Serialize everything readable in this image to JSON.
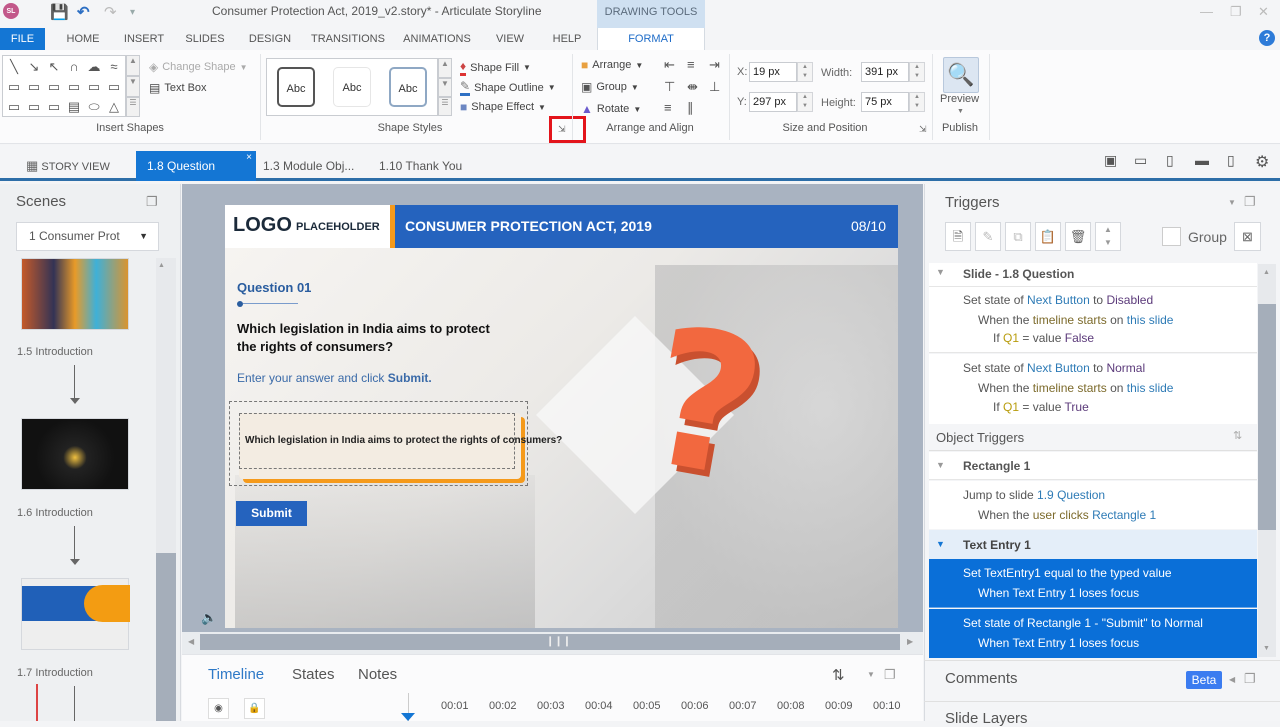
{
  "app": {
    "title": "Consumer Protection Act, 2019_v2.story* - Articulate Storyline",
    "icon_label": "SL",
    "context_tab_group": "DRAWING TOOLS"
  },
  "menu": {
    "tabs": [
      "FILE",
      "HOME",
      "INSERT",
      "SLIDES",
      "DESIGN",
      "TRANSITIONS",
      "ANIMATIONS",
      "VIEW",
      "HELP",
      "FORMAT"
    ],
    "active": "FORMAT"
  },
  "ribbon": {
    "insert_shapes": {
      "label": "Insert Shapes",
      "change_shape": "Change Shape",
      "text_box": "Text Box"
    },
    "shape_styles": {
      "label": "Shape Styles",
      "samples": [
        "Abc",
        "Abc",
        "Abc"
      ],
      "shape_fill": "Shape Fill",
      "shape_outline": "Shape Outline",
      "shape_effect": "Shape Effect"
    },
    "arrange": {
      "label": "Arrange and Align",
      "arrange": "Arrange",
      "group": "Group",
      "rotate": "Rotate"
    },
    "size_position": {
      "label": "Size and Position",
      "x_label": "X:",
      "x_value": "19 px",
      "y_label": "Y:",
      "y_value": "297 px",
      "width_label": "Width:",
      "width_value": "391 px",
      "height_label": "Height:",
      "height_value": "75 px"
    },
    "publish": {
      "label": "Publish",
      "preview": "Preview"
    }
  },
  "slide_tabs": {
    "story_view": "STORY VIEW",
    "tabs": [
      "1.8 Question",
      "1.3 Module Obj...",
      "1.10 Thank You"
    ],
    "active": "1.8 Question"
  },
  "scenes": {
    "title": "Scenes",
    "selected_scene": "1 Consumer Prot",
    "slides": [
      {
        "label": "1.5 Introduction"
      },
      {
        "label": "1.6 Introduction"
      },
      {
        "label": "1.7 Introduction"
      }
    ]
  },
  "slide": {
    "logo": "LOGO",
    "logo_sub": "PLACEHOLDER",
    "header": "CONSUMER PROTECTION ACT, 2019",
    "page": "08/10",
    "question_label": "Question 01",
    "question": "Which legislation in India aims to protect the rights of consumers?",
    "instruction": "Enter your answer and click",
    "instruction_link": "Submit.",
    "text_entry": "Which legislation in India aims to protect the rights of consumers?",
    "submit": "Submit",
    "colors": {
      "header": "#2563be",
      "accent": "#f59a1b",
      "question_mark": "#f2683f"
    }
  },
  "bottom_panel": {
    "tabs": [
      "Timeline",
      "States",
      "Notes"
    ],
    "active": "Timeline",
    "ticks": [
      "00:01",
      "00:02",
      "00:03",
      "00:04",
      "00:05",
      "00:06",
      "00:07",
      "00:08",
      "00:09",
      "00:10"
    ]
  },
  "triggers": {
    "title": "Triggers",
    "group_label": "Group",
    "slide_section": "Slide - 1.8 Question",
    "slide_triggers": [
      {
        "action": "Set state of",
        "target": "Next Button",
        "to": "to",
        "state": "Disabled",
        "when": "When the",
        "event": "timeline starts",
        "on": "on",
        "obj": "this slide",
        "cond_if": "If",
        "var": "Q1",
        "cond": "= value",
        "val": "False"
      },
      {
        "action": "Set state of",
        "target": "Next Button",
        "to": "to",
        "state": "Normal",
        "when": "When the",
        "event": "timeline starts",
        "on": "on",
        "obj": "this slide",
        "cond_if": "If",
        "var": "Q1",
        "cond": "= value",
        "val": "True"
      }
    ],
    "object_section": "Object Triggers",
    "objects": [
      {
        "name": "Rectangle 1",
        "items": [
          {
            "line1a": "Jump to slide",
            "line1b": "1.9 Question",
            "line2a": "When the",
            "line2b": "user clicks",
            "line2c": "Rectangle 1"
          }
        ]
      },
      {
        "name": "Text Entry 1",
        "items": [
          {
            "line1": "Set TextEntry1 equal to the typed value",
            "line2": "When Text Entry 1 loses focus"
          },
          {
            "line1": "Set state of Rectangle 1 - \"Submit\" to Normal",
            "line2": "When Text Entry 1 loses focus"
          }
        ]
      }
    ],
    "comments": "Comments",
    "beta": "Beta",
    "slide_layers": "Slide Layers"
  }
}
